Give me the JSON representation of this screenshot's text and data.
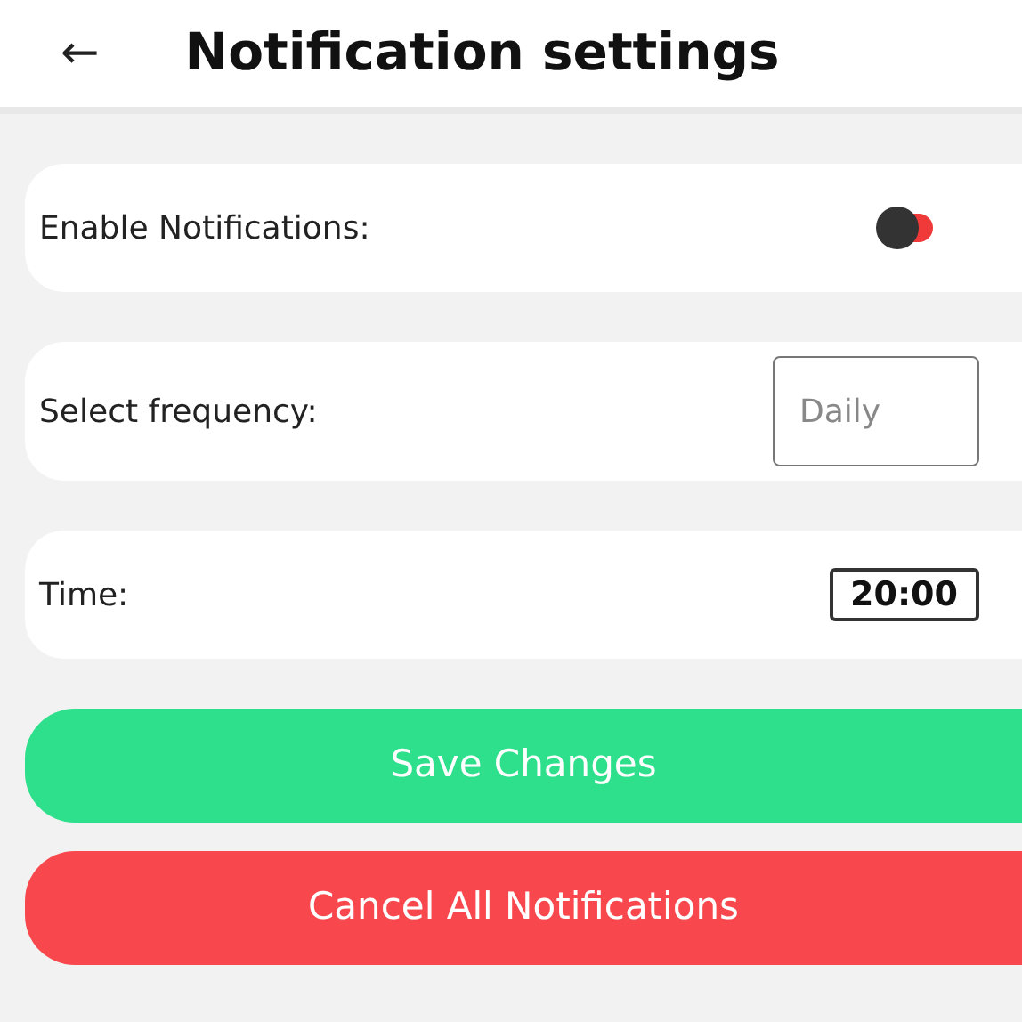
{
  "header": {
    "back": "←",
    "title": "Notification settings"
  },
  "settings": [
    {
      "kind": "toggle",
      "label": "Enable Notifications:",
      "on": false
    },
    {
      "kind": "select",
      "label": "Select frequency:",
      "placeholder": "Daily"
    },
    {
      "kind": "time",
      "label": "Time:",
      "value": "20:00"
    }
  ],
  "buttons": [
    {
      "label": "Save Changes",
      "color": "#2ee08c"
    },
    {
      "label": "Cancel All Notifications",
      "color": "#f8484e"
    }
  ]
}
